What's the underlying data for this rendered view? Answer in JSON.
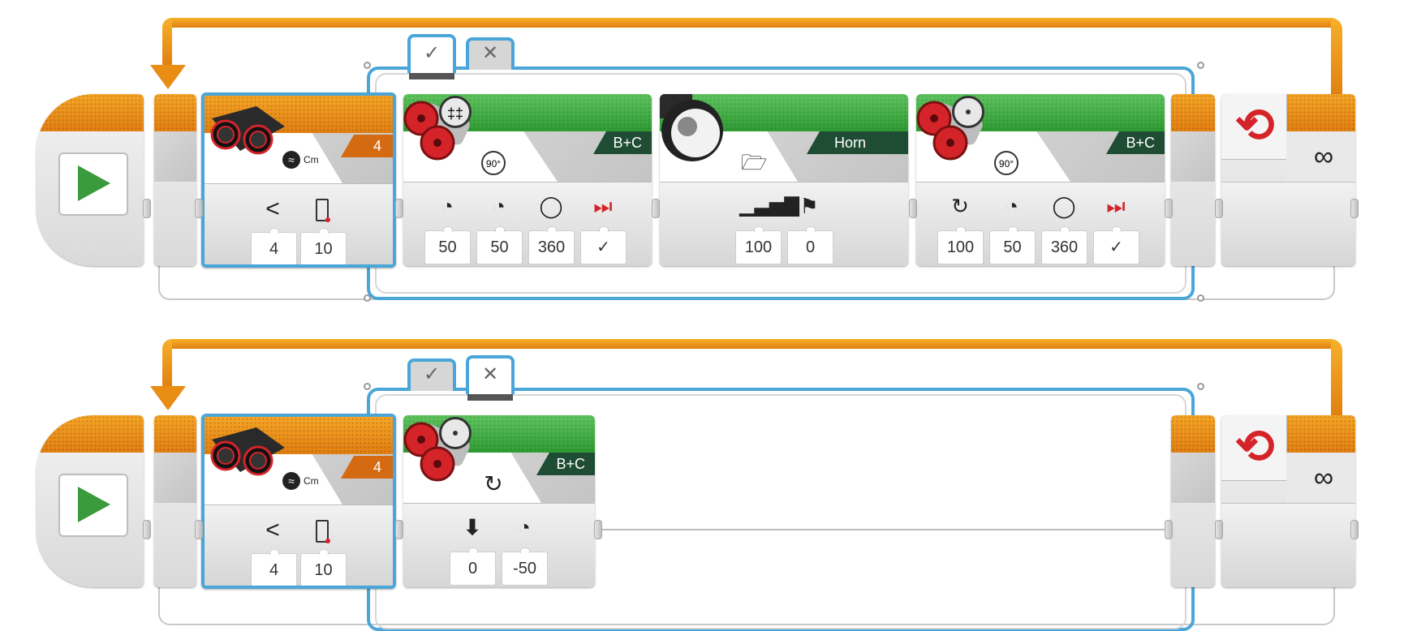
{
  "programs": [
    {
      "tabs": {
        "true_label": "✓",
        "false_label": "✕",
        "active": "true"
      },
      "sensor": {
        "port": "4",
        "compare_symbol": "<",
        "values": [
          "4",
          "10"
        ],
        "unit": "Cm"
      },
      "blocks": [
        {
          "type": "move-tank",
          "port": "B+C",
          "mode_icon": "90°",
          "params": [
            "50",
            "50",
            "360",
            "✓"
          ]
        },
        {
          "type": "sound",
          "port": "Horn 1",
          "params": [
            "100",
            "0"
          ]
        },
        {
          "type": "move-steering",
          "port": "B+C",
          "mode_icon": "90°",
          "params": [
            "100",
            "50",
            "360",
            "✓"
          ]
        }
      ],
      "loop_label": "∞"
    },
    {
      "tabs": {
        "true_label": "✓",
        "false_label": "✕",
        "active": "false"
      },
      "sensor": {
        "port": "4",
        "compare_symbol": "<",
        "values": [
          "4",
          "10"
        ],
        "unit": "Cm"
      },
      "blocks": [
        {
          "type": "move-steering",
          "port": "B+C",
          "mode_icon": "on",
          "params": [
            "0",
            "-50"
          ]
        }
      ],
      "loop_label": "∞"
    }
  ]
}
